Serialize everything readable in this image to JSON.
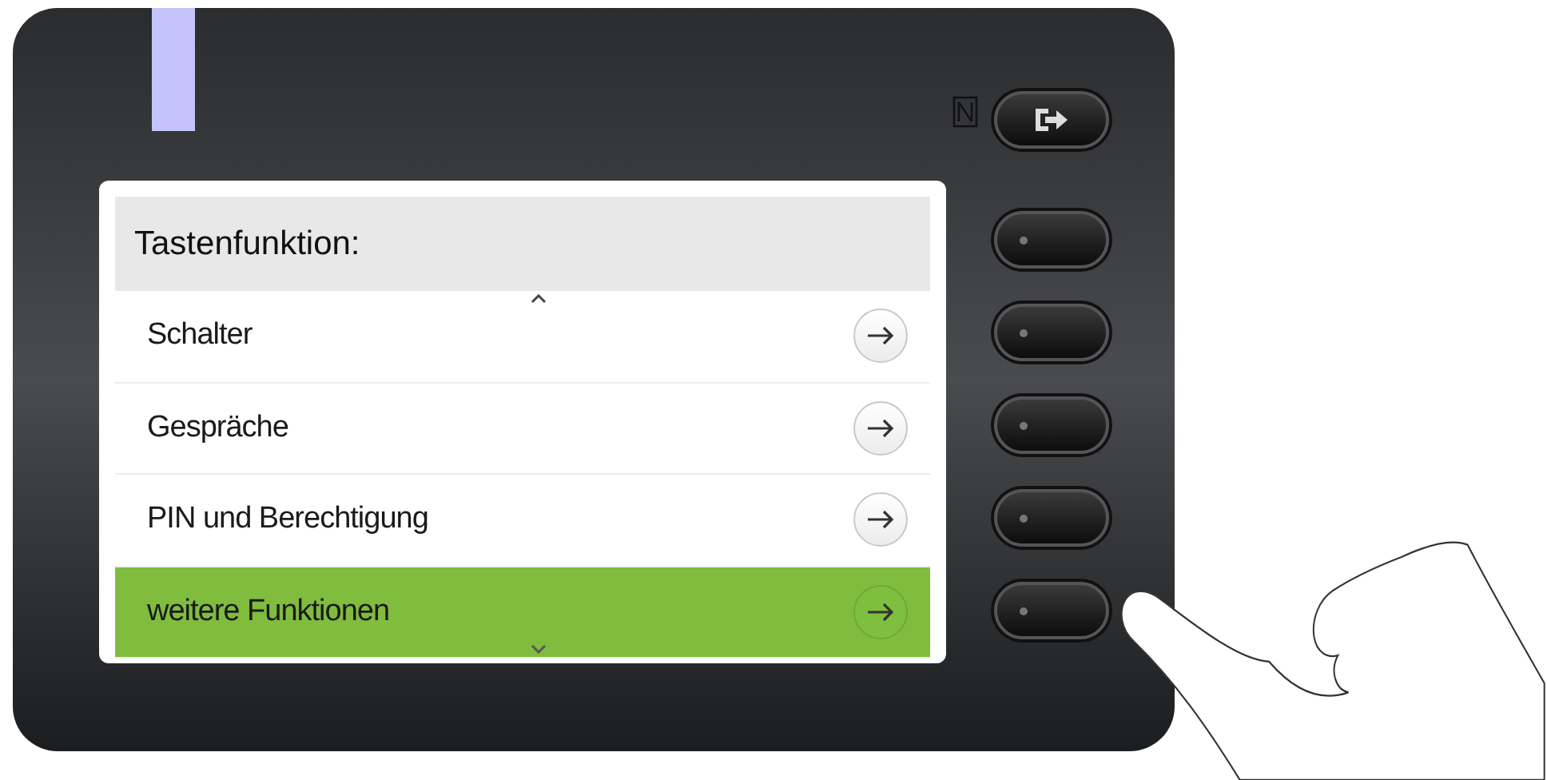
{
  "screen": {
    "title": "Tastenfunktion:",
    "items": [
      {
        "label": "Schalter",
        "selected": false
      },
      {
        "label": "Gespräche",
        "selected": false
      },
      {
        "label": "PIN und Berechtigung",
        "selected": false
      },
      {
        "label": "weitere Funktionen",
        "selected": true
      }
    ]
  }
}
